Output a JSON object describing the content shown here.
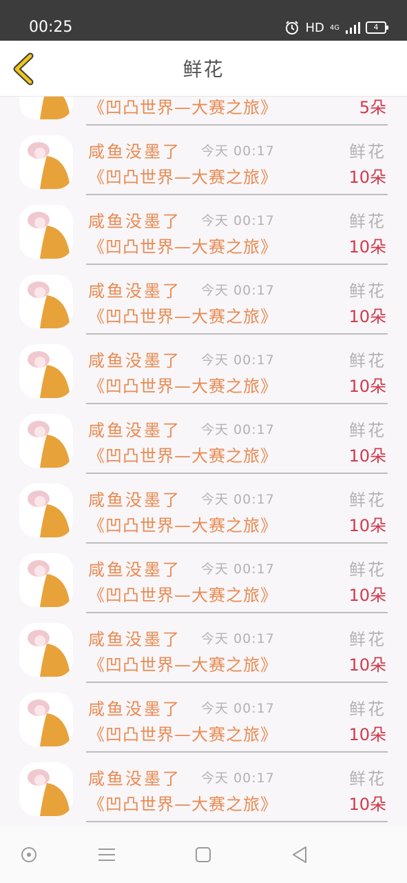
{
  "status_bar": {
    "time": "00:25",
    "hd": "HD",
    "network": "4G",
    "battery": "4",
    "icons": [
      "alarm-icon",
      "signal-icon",
      "battery-icon"
    ]
  },
  "header": {
    "title": "鲜花",
    "back_icon": "chevron-left-icon",
    "back_color": "#f0c419"
  },
  "colors": {
    "orange_text": "#e98a52",
    "gray_text": "#b3b3b3",
    "amount_red": "#cf3b4e",
    "status_bar_bg": "#3c3c3c"
  },
  "records": [
    {
      "name": "",
      "time": "",
      "type": "",
      "book": "《凹凸世界—大赛之旅》",
      "amount": "5朵"
    },
    {
      "name": "咸鱼没墨了",
      "time": "今天 00:17",
      "type": "鲜花",
      "book": "《凹凸世界—大赛之旅》",
      "amount": "10朵"
    },
    {
      "name": "咸鱼没墨了",
      "time": "今天 00:17",
      "type": "鲜花",
      "book": "《凹凸世界—大赛之旅》",
      "amount": "10朵"
    },
    {
      "name": "咸鱼没墨了",
      "time": "今天 00:17",
      "type": "鲜花",
      "book": "《凹凸世界—大赛之旅》",
      "amount": "10朵"
    },
    {
      "name": "咸鱼没墨了",
      "time": "今天 00:17",
      "type": "鲜花",
      "book": "《凹凸世界—大赛之旅》",
      "amount": "10朵"
    },
    {
      "name": "咸鱼没墨了",
      "time": "今天 00:17",
      "type": "鲜花",
      "book": "《凹凸世界—大赛之旅》",
      "amount": "10朵"
    },
    {
      "name": "咸鱼没墨了",
      "time": "今天 00:17",
      "type": "鲜花",
      "book": "《凹凸世界—大赛之旅》",
      "amount": "10朵"
    },
    {
      "name": "咸鱼没墨了",
      "time": "今天 00:17",
      "type": "鲜花",
      "book": "《凹凸世界—大赛之旅》",
      "amount": "10朵"
    },
    {
      "name": "咸鱼没墨了",
      "time": "今天 00:17",
      "type": "鲜花",
      "book": "《凹凸世界—大赛之旅》",
      "amount": "10朵"
    },
    {
      "name": "咸鱼没墨了",
      "time": "今天 00:17",
      "type": "鲜花",
      "book": "《凹凸世界—大赛之旅》",
      "amount": "10朵"
    },
    {
      "name": "咸鱼没墨了",
      "time": "今天 00:17",
      "type": "鲜花",
      "book": "《凹凸世界—大赛之旅》",
      "amount": "10朵"
    }
  ],
  "nav_bar": {
    "icons": [
      "home-circle-icon",
      "menu-icon",
      "overview-square-icon",
      "back-triangle-icon"
    ]
  }
}
